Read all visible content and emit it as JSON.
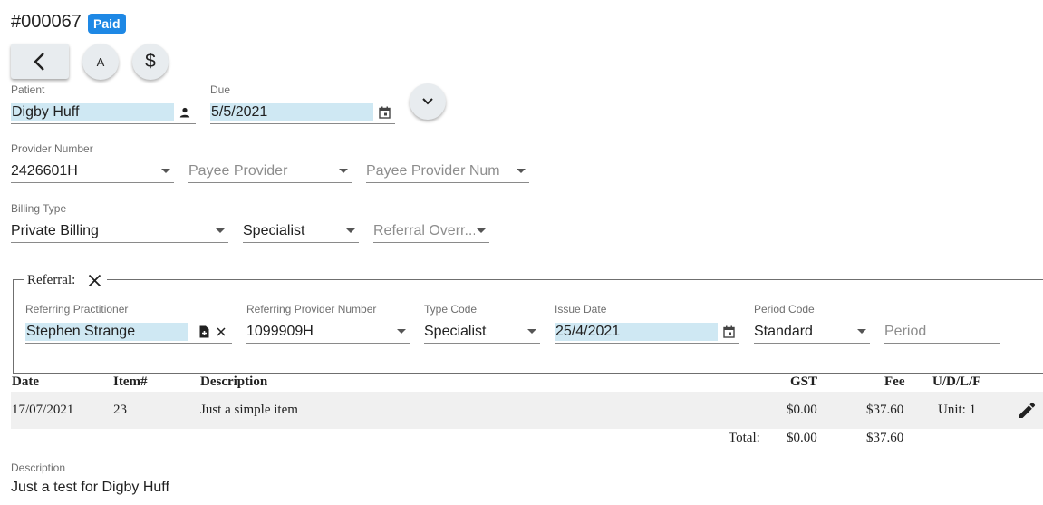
{
  "header": {
    "invoice_number": "#000067",
    "status_badge": "Paid"
  },
  "toolbar": {
    "a_label": "A",
    "dollar_label": "$"
  },
  "patient": {
    "label": "Patient",
    "value": "Digby Huff"
  },
  "due": {
    "label": "Due",
    "value": "5/5/2021"
  },
  "provider_number": {
    "label": "Provider Number",
    "value": "2426601H"
  },
  "payee_provider": {
    "placeholder": "Payee Provider"
  },
  "payee_provider_num": {
    "placeholder": "Payee Provider Num"
  },
  "billing_type": {
    "label": "Billing Type",
    "value": "Private Billing"
  },
  "specialty": {
    "value": "Specialist"
  },
  "referral_override": {
    "placeholder": "Referral Overr..."
  },
  "referral": {
    "legend": "Referral:",
    "referring_practitioner": {
      "label": "Referring Practitioner",
      "value": "Stephen Strange"
    },
    "referring_provider_number": {
      "label": "Referring Provider Number",
      "value": "1099909H"
    },
    "type_code": {
      "label": "Type Code",
      "value": "Specialist"
    },
    "issue_date": {
      "label": "Issue Date",
      "value": "25/4/2021"
    },
    "period_code": {
      "label": "Period Code",
      "value": "Standard"
    },
    "period": {
      "placeholder": "Period"
    }
  },
  "items_table": {
    "columns": [
      "Date",
      "Item#",
      "Description",
      "GST",
      "Fee",
      "U/D/L/F"
    ],
    "rows": [
      {
        "date": "17/07/2021",
        "item": "23",
        "description": "Just a simple item",
        "gst": "$0.00",
        "fee": "$37.60",
        "udlf": "Unit: 1"
      }
    ],
    "total_label": "Total:",
    "total_gst": "$0.00",
    "total_fee": "$37.60"
  },
  "description": {
    "label": "Description",
    "value": "Just a test for Digby Huff"
  },
  "colors": {
    "badge": "#1e88e5",
    "highlight": "#cfe8f3",
    "button_bg": "#e8ecef"
  }
}
